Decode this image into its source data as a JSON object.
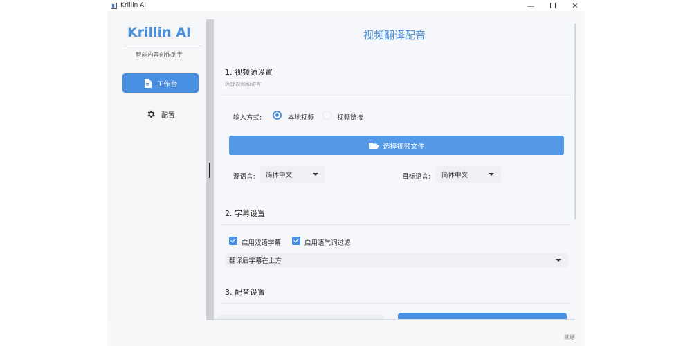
{
  "window": {
    "title": "Krillin AI",
    "controls": {
      "minimize": "—",
      "close": "✕"
    }
  },
  "sidebar": {
    "brand": "Krillin AI",
    "subtitle": "智能内容创作助手",
    "items": [
      {
        "label": "工作台",
        "icon": "file-icon",
        "active": true
      },
      {
        "label": "配置",
        "icon": "gear-icon",
        "active": false
      }
    ]
  },
  "main": {
    "title": "视频翻译配音",
    "section1": {
      "title": "1. 视频源设置",
      "hint": "选择视频和语言",
      "input_mode_label": "输入方式:",
      "options": [
        {
          "label": "本地视频",
          "selected": true
        },
        {
          "label": "视频链接",
          "selected": false
        }
      ],
      "select_button": "选择视频文件",
      "source_lang_label": "源语言:",
      "source_lang_value": "简体中文",
      "target_lang_label": "目标语言:",
      "target_lang_value": "简体中文"
    },
    "section2": {
      "title": "2. 字幕设置",
      "checkboxes": [
        {
          "label": "启用双语字幕",
          "checked": true
        },
        {
          "label": "启用语气词过滤",
          "checked": true
        }
      ],
      "position_value": "翻译后字幕在上方"
    },
    "section3": {
      "title": "3. 配音设置"
    }
  },
  "status": "就绪",
  "colors": {
    "accent": "#4a90e2",
    "brand": "#4a90d9"
  }
}
